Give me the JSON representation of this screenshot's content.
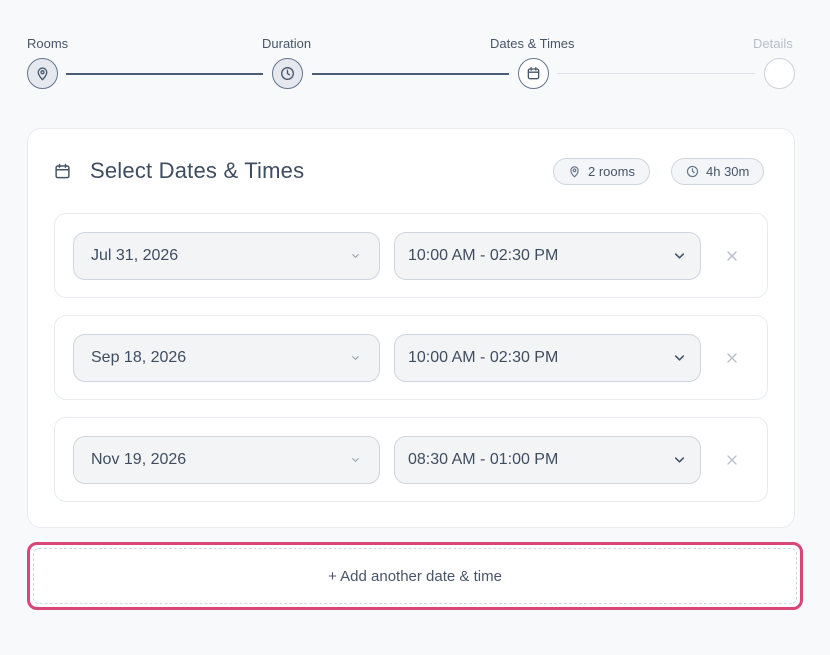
{
  "stepper": {
    "steps": [
      {
        "label": "Rooms",
        "icon": "map-pin-icon",
        "state": "completed"
      },
      {
        "label": "Duration",
        "icon": "clock-icon",
        "state": "completed"
      },
      {
        "label": "Dates & Times",
        "icon": "calendar-icon",
        "state": "current"
      },
      {
        "label": "Details",
        "icon": "",
        "state": "upcoming"
      }
    ]
  },
  "card": {
    "title": "Select Dates & Times",
    "title_icon": "calendar-icon",
    "rooms_pill": "2 rooms",
    "duration_pill": "4h 30m"
  },
  "rows": [
    {
      "date": "Jul 31, 2026",
      "time": "10:00 AM - 02:30 PM"
    },
    {
      "date": "Sep 18, 2026",
      "time": "10:00 AM - 02:30 PM"
    },
    {
      "date": "Nov 19, 2026",
      "time": "08:30 AM - 01:00 PM"
    }
  ],
  "add_button": {
    "label": "+ Add another date & time"
  },
  "colors": {
    "accent_outline": "#d94675",
    "stepper_line": "#4b5d74",
    "text": "#3f4d60"
  }
}
